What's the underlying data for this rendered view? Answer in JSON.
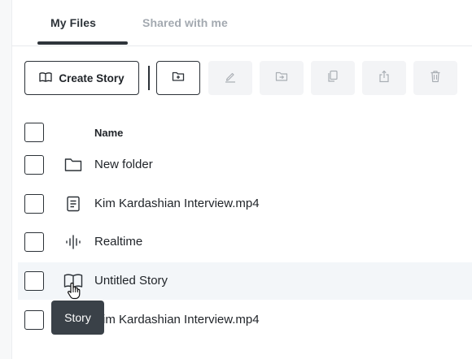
{
  "tabs": [
    {
      "label": "My Files",
      "active": true
    },
    {
      "label": "Shared with me",
      "active": false
    }
  ],
  "toolbar": {
    "create_story_label": "Create Story",
    "buttons": [
      {
        "icon": "new-folder-icon",
        "enabled": true
      },
      {
        "icon": "rename-pencil-icon",
        "enabled": false
      },
      {
        "icon": "move-to-folder-icon",
        "enabled": false
      },
      {
        "icon": "duplicate-icon",
        "enabled": false
      },
      {
        "icon": "share-export-icon",
        "enabled": false
      },
      {
        "icon": "trash-icon",
        "enabled": false
      }
    ]
  },
  "table": {
    "header": "Name",
    "rows": [
      {
        "name": "New folder",
        "icon": "folder-icon",
        "highlighted": false
      },
      {
        "name": "Kim Kardashian Interview.mp4",
        "icon": "document-icon",
        "highlighted": false
      },
      {
        "name": "Realtime",
        "icon": "audio-waveform-icon",
        "highlighted": false
      },
      {
        "name": "Untitled Story",
        "icon": "open-book-icon",
        "highlighted": true
      },
      {
        "name": "Kim Kardashian Interview.mp4",
        "icon": "document-icon",
        "highlighted": false
      }
    ]
  },
  "tooltip": {
    "text": "Story"
  },
  "colors": {
    "primary_text": "#1f2328",
    "inactive_tab": "#a3a9b0",
    "border": "#2b3137",
    "disabled_button_bg": "#f3f4f6",
    "row_highlight": "#f3f6f9",
    "tooltip_bg": "#3a4148"
  }
}
